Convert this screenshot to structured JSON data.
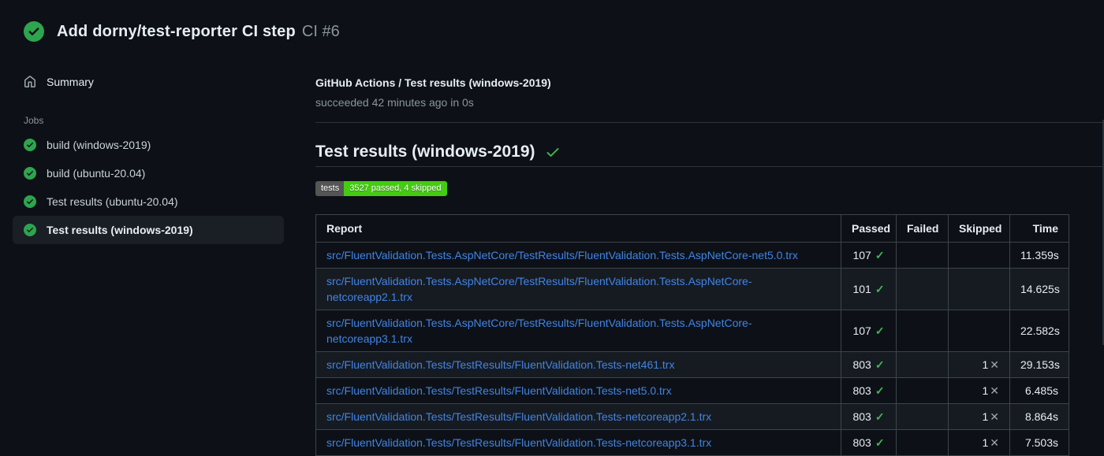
{
  "icons": {
    "check": "✓",
    "cross": "✕"
  },
  "colors": {
    "background": "#0d1117",
    "row_alt": "#161b22",
    "circle_green": "#2ea44e",
    "check_green": "#3fb950",
    "link_blue": "#4184e4",
    "badge_label_bg": "#555555",
    "badge_value_bg": "#44cc11"
  },
  "header": {
    "run_title": "Add dorny/test-reporter CI step",
    "run_number": "CI #6"
  },
  "sidebar": {
    "summary_label": "Summary",
    "jobs_label": "Jobs",
    "jobs": [
      {
        "label": "build (windows-2019)",
        "selected": false
      },
      {
        "label": "build (ubuntu-20.04)",
        "selected": false
      },
      {
        "label": "Test results (ubuntu-20.04)",
        "selected": false
      },
      {
        "label": "Test results (windows-2019)",
        "selected": true
      }
    ]
  },
  "main": {
    "check_title": "GitHub Actions / Test results (windows-2019)",
    "check_status": "succeeded 42 minutes ago in 0s",
    "section_heading": "Test results (windows-2019)",
    "badge": {
      "label": "tests",
      "value": "3527 passed, 4 skipped"
    },
    "table": {
      "columns": [
        "Report",
        "Passed",
        "Failed",
        "Skipped",
        "Time"
      ],
      "rows": [
        {
          "report": "src/FluentValidation.Tests.AspNetCore/TestResults/FluentValidation.Tests.AspNetCore-net5.0.trx",
          "passed": "107",
          "failed": "",
          "skipped": "",
          "time": "11.359s"
        },
        {
          "report": "src/FluentValidation.Tests.AspNetCore/TestResults/FluentValidation.Tests.AspNetCore-netcoreapp2.1.trx",
          "passed": "101",
          "failed": "",
          "skipped": "",
          "time": "14.625s"
        },
        {
          "report": "src/FluentValidation.Tests.AspNetCore/TestResults/FluentValidation.Tests.AspNetCore-netcoreapp3.1.trx",
          "passed": "107",
          "failed": "",
          "skipped": "",
          "time": "22.582s"
        },
        {
          "report": "src/FluentValidation.Tests/TestResults/FluentValidation.Tests-net461.trx",
          "passed": "803",
          "failed": "",
          "skipped": "1",
          "time": "29.153s"
        },
        {
          "report": "src/FluentValidation.Tests/TestResults/FluentValidation.Tests-net5.0.trx",
          "passed": "803",
          "failed": "",
          "skipped": "1",
          "time": "6.485s"
        },
        {
          "report": "src/FluentValidation.Tests/TestResults/FluentValidation.Tests-netcoreapp2.1.trx",
          "passed": "803",
          "failed": "",
          "skipped": "1",
          "time": "8.864s"
        },
        {
          "report": "src/FluentValidation.Tests/TestResults/FluentValidation.Tests-netcoreapp3.1.trx",
          "passed": "803",
          "failed": "",
          "skipped": "1",
          "time": "7.503s"
        }
      ]
    }
  }
}
